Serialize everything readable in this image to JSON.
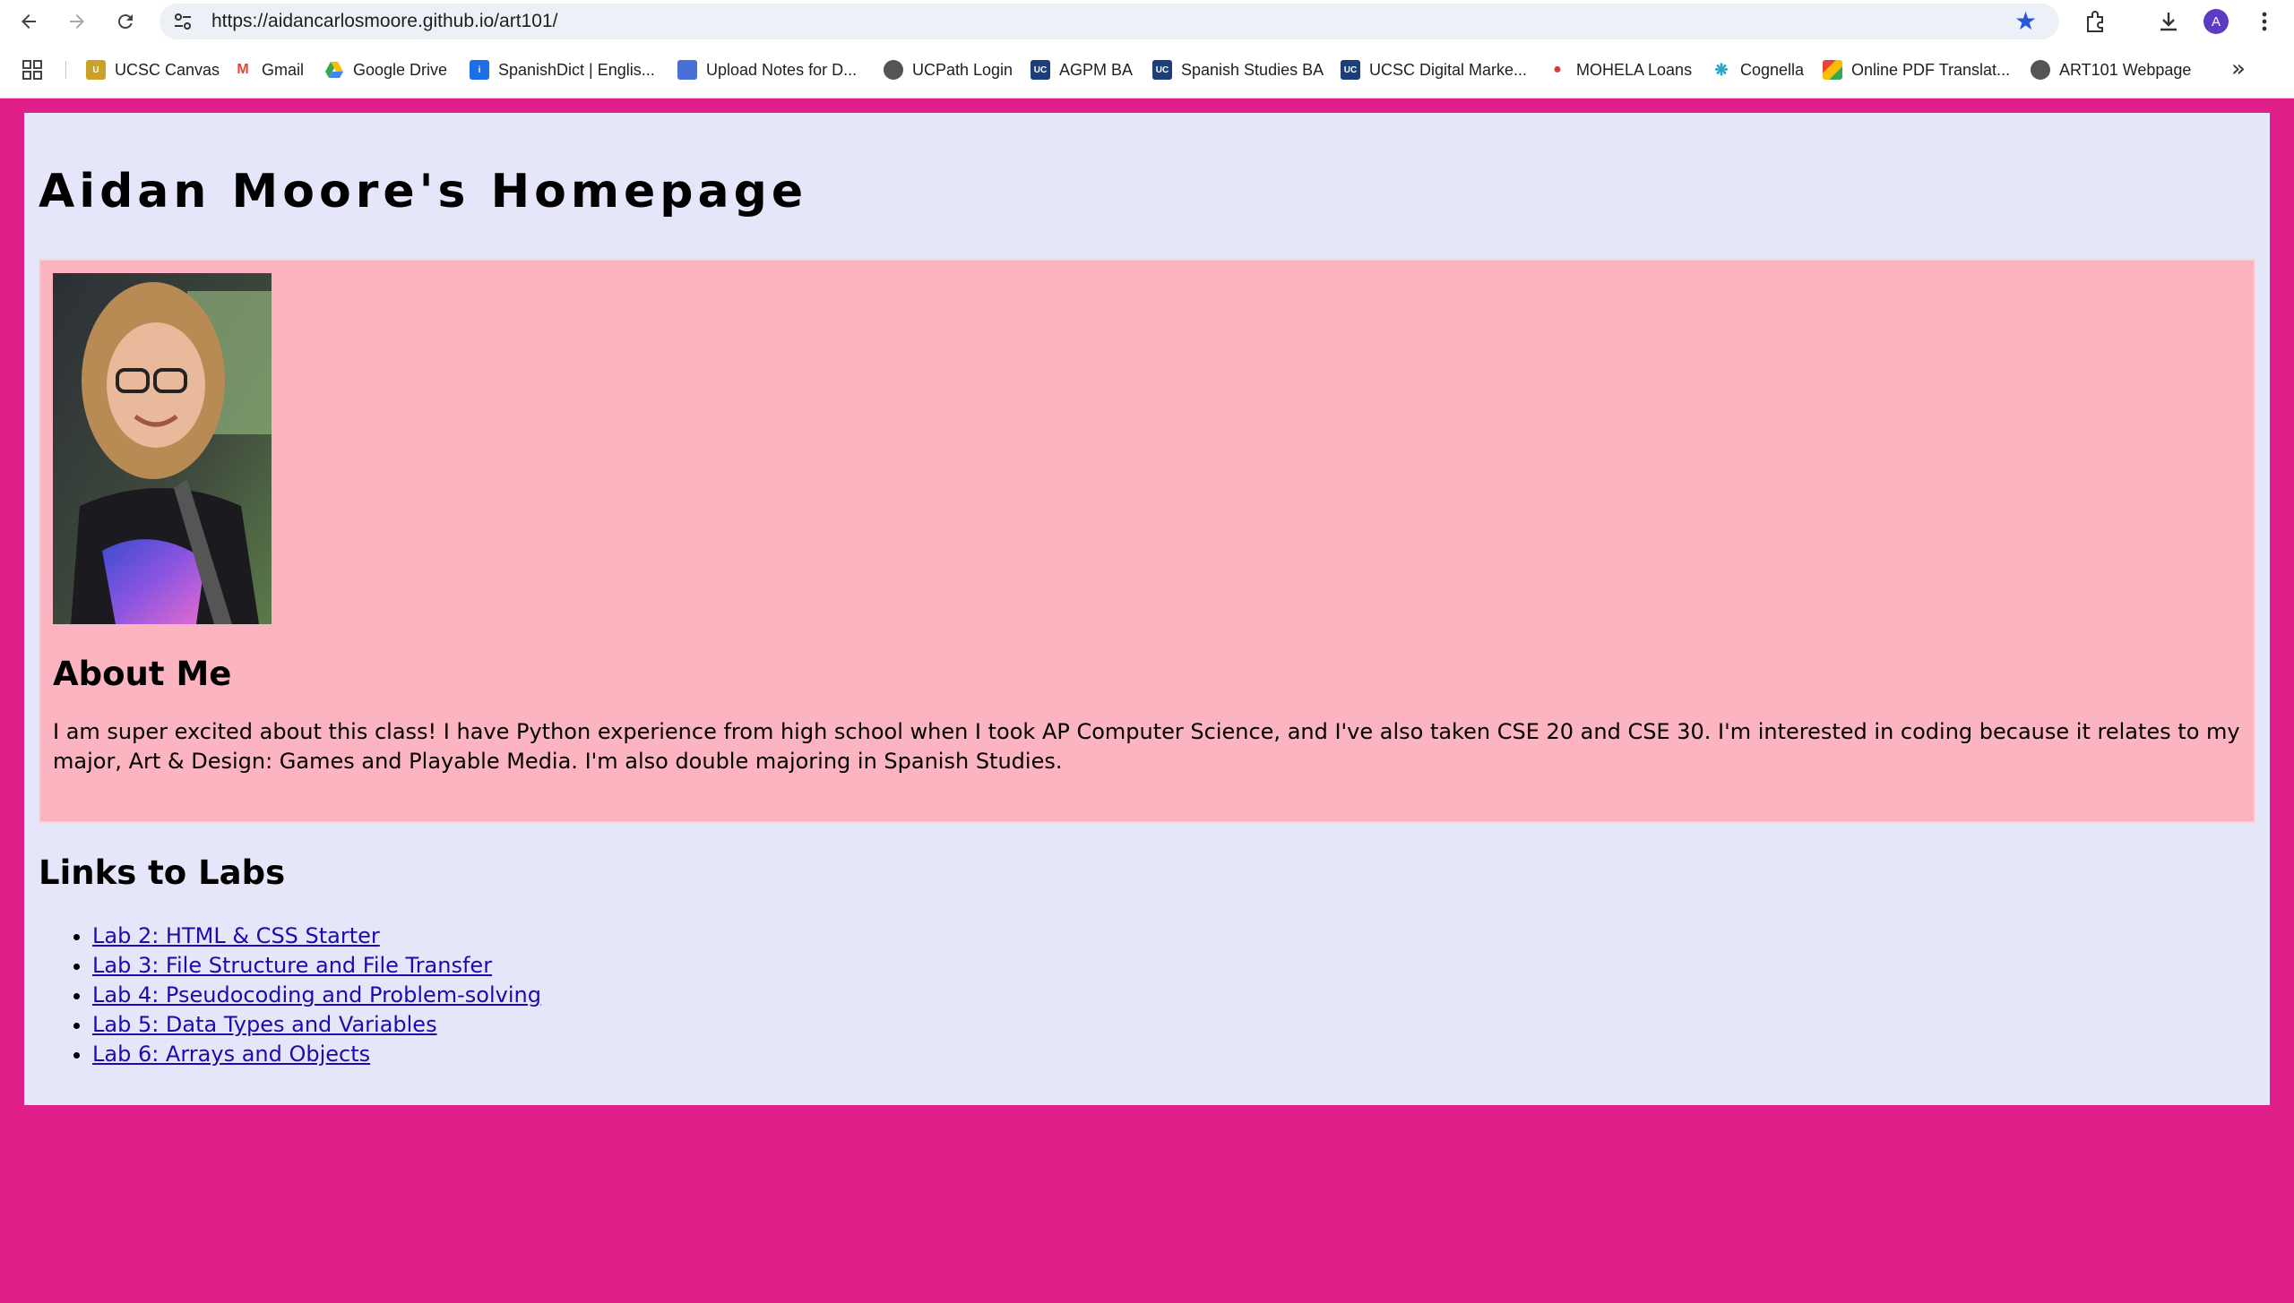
{
  "browser": {
    "url": "https://aidancarlosmoore.github.io/art101/",
    "profile_initial": "A",
    "bookmarks": [
      {
        "label": "UCSC Canvas",
        "icon": "canvas-icon",
        "color": "#c9a227"
      },
      {
        "label": "Gmail",
        "icon": "gmail-icon",
        "color": "#ea4335"
      },
      {
        "label": "Google Drive",
        "icon": "drive-icon",
        "color": "#34a853"
      },
      {
        "label": "SpanishDict | Englis...",
        "icon": "spanishdict-icon",
        "color": "#1e6ee8"
      },
      {
        "label": "Upload Notes for D...",
        "icon": "notes-icon",
        "color": "#4a6fd6"
      },
      {
        "label": "UCPath Login",
        "icon": "globe-icon",
        "color": "#555555"
      },
      {
        "label": "AGPM BA",
        "icon": "ucsc-icon",
        "color": "#1c3f7a"
      },
      {
        "label": "Spanish Studies BA",
        "icon": "ucsc-icon",
        "color": "#1c3f7a"
      },
      {
        "label": "UCSC Digital Marke...",
        "icon": "ucsc-icon",
        "color": "#1c3f7a"
      },
      {
        "label": "MOHELA Loans",
        "icon": "mohela-icon",
        "color": "#d33c3c"
      },
      {
        "label": "Cognella",
        "icon": "cognella-icon",
        "color": "#2ba6c9"
      },
      {
        "label": "Online PDF Translat...",
        "icon": "pdf-translate-icon",
        "color": "#e0a020"
      },
      {
        "label": "ART101 Webpage",
        "icon": "globe-icon",
        "color": "#555555"
      }
    ]
  },
  "page": {
    "title": "Aidan Moore's Homepage",
    "about": {
      "heading": "About Me",
      "text": "I am super excited about this class! I have Python experience from high school when I took AP Computer Science, and I've also taken CSE 20 and CSE 30. I'm interested in coding because it relates to my major, Art & Design: Games and Playable Media. I'm also double majoring in Spanish Studies."
    },
    "labs": {
      "heading": "Links to Labs",
      "items": [
        "Lab 2: HTML & CSS Starter",
        "Lab 3: File Structure and File Transfer",
        "Lab 4: Pseudocoding and Problem-solving",
        "Lab 5: Data Types and Variables",
        "Lab 6: Arrays and Objects"
      ]
    }
  },
  "colors": {
    "body_bg": "#e01f8a",
    "page_bg": "#e6e6fa",
    "about_bg": "#fbb4c0",
    "link": "#1a0dab"
  }
}
